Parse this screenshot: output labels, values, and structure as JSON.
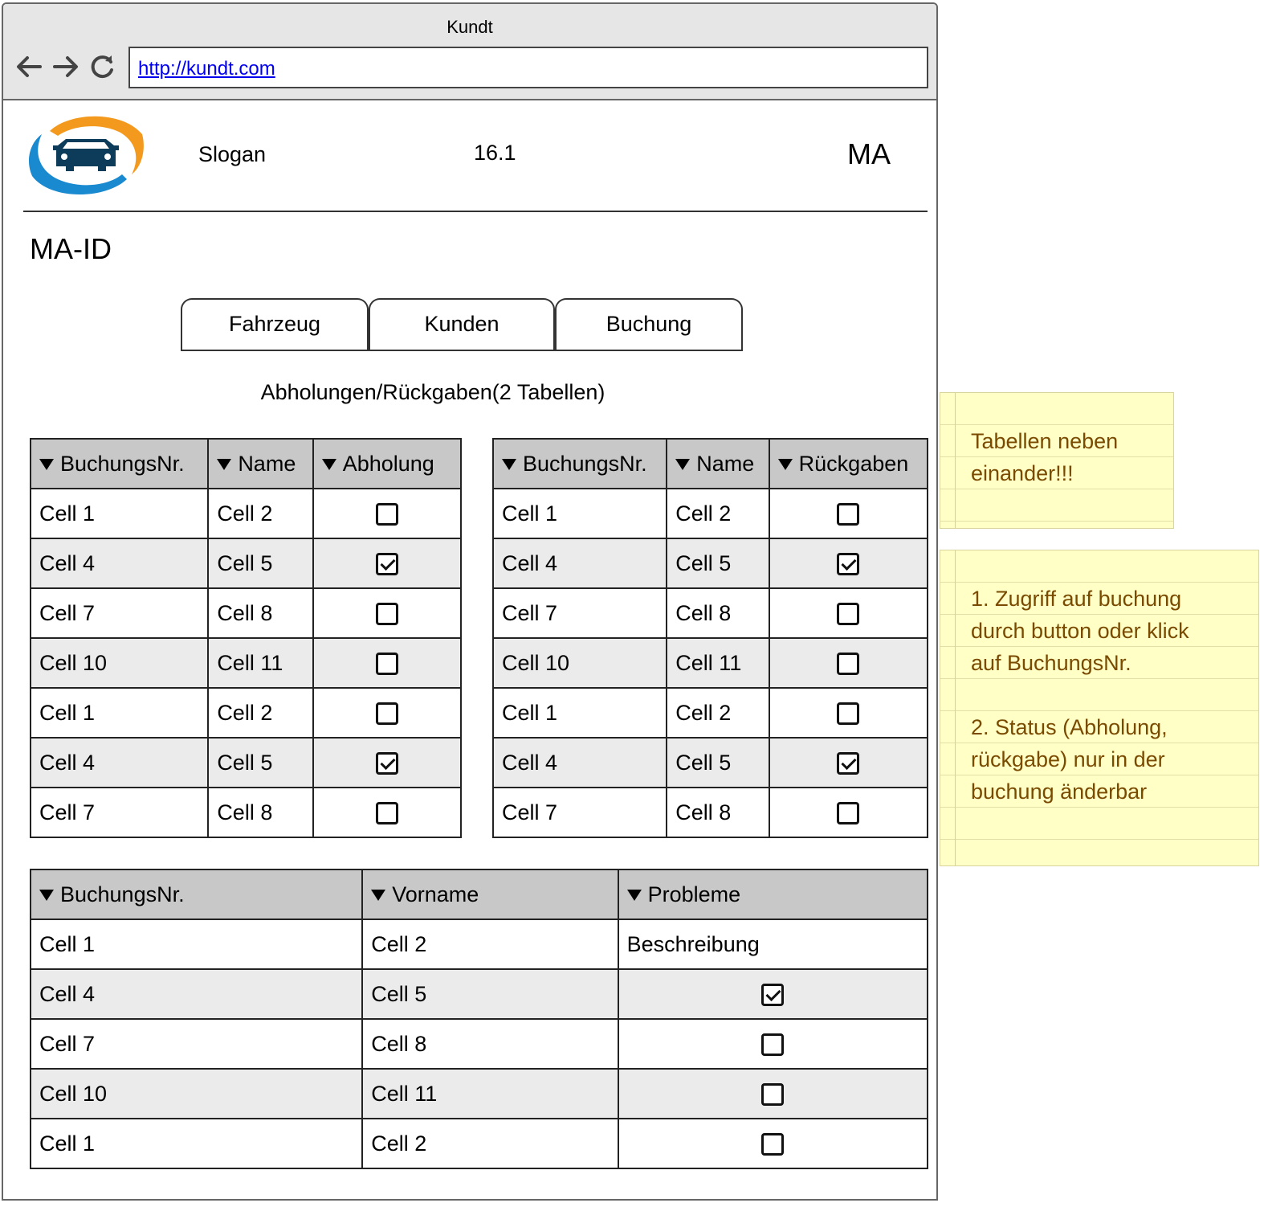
{
  "browser": {
    "title": "Kundt",
    "url": "http://kundt.com"
  },
  "header": {
    "slogan": "Slogan",
    "version": "16.1",
    "role": "MA"
  },
  "page": {
    "id_label": "MA-ID",
    "subtitle": "Abholungen/Rückgaben(2 Tabellen)"
  },
  "tabs": [
    {
      "label": "Fahrzeug"
    },
    {
      "label": "Kunden"
    },
    {
      "label": "Buchung"
    }
  ],
  "pickup_table": {
    "headers": [
      "BuchungsNr.",
      "Name",
      "Abholung"
    ],
    "rows": [
      {
        "c1": "Cell 1",
        "c2": "Cell 2",
        "checked": false
      },
      {
        "c1": "Cell 4",
        "c2": "Cell 5",
        "checked": true
      },
      {
        "c1": "Cell 7",
        "c2": "Cell 8",
        "checked": false
      },
      {
        "c1": "Cell 10",
        "c2": "Cell 11",
        "checked": false
      },
      {
        "c1": "Cell 1",
        "c2": "Cell 2",
        "checked": false
      },
      {
        "c1": "Cell 4",
        "c2": "Cell 5",
        "checked": true
      },
      {
        "c1": "Cell 7",
        "c2": "Cell 8",
        "checked": false
      }
    ]
  },
  "return_table": {
    "headers": [
      "BuchungsNr.",
      "Name",
      "Rückgaben"
    ],
    "rows": [
      {
        "c1": "Cell 1",
        "c2": "Cell 2",
        "checked": false
      },
      {
        "c1": "Cell 4",
        "c2": "Cell 5",
        "checked": true
      },
      {
        "c1": "Cell 7",
        "c2": "Cell 8",
        "checked": false
      },
      {
        "c1": "Cell 10",
        "c2": "Cell 11",
        "checked": false
      },
      {
        "c1": "Cell 1",
        "c2": "Cell 2",
        "checked": false
      },
      {
        "c1": "Cell 4",
        "c2": "Cell 5",
        "checked": true
      },
      {
        "c1": "Cell 7",
        "c2": "Cell 8",
        "checked": false
      }
    ]
  },
  "problems_table": {
    "headers": [
      "BuchungsNr.",
      "Vorname",
      "Probleme"
    ],
    "rows": [
      {
        "c1": "Cell 1",
        "c2": "Cell 2",
        "text": "Beschreibung"
      },
      {
        "c1": "Cell 4",
        "c2": "Cell 5",
        "checked": true
      },
      {
        "c1": "Cell 7",
        "c2": "Cell 8",
        "checked": false
      },
      {
        "c1": "Cell 10",
        "c2": "Cell 11",
        "checked": false
      },
      {
        "c1": "Cell 1",
        "c2": "Cell 2",
        "checked": false
      }
    ]
  },
  "notes": [
    {
      "lines": [
        "Tabellen neben",
        "einander!!!"
      ]
    },
    {
      "lines": [
        "1. Zugriff auf buchung",
        "durch button oder klick",
        "auf BuchungsNr.",
        "",
        "2. Status (Abholung,",
        "rückgabe) nur in der",
        "buchung änderbar"
      ]
    }
  ],
  "colors": {
    "header_bg": "#c8c8c8",
    "alt_row": "#ebebeb",
    "note_bg": "#ffffc6",
    "note_text": "#7a4a00",
    "logo_orange": "#f39a1e",
    "logo_blue": "#1a8ad0",
    "logo_car": "#0d3b5a"
  }
}
